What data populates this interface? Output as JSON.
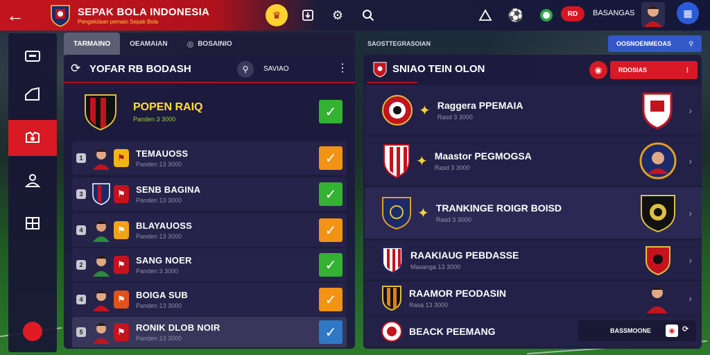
{
  "header": {
    "title": "SEPAK BOLA INDONESIA",
    "subtitle": "Pengelolaan pemain Sepak Bola",
    "user_name": "BASANGAS",
    "notif_label": "RD"
  },
  "tabs": [
    {
      "label": "TARMAINO"
    },
    {
      "label": "OEAMAIAN"
    },
    {
      "label": "BOSAINIO"
    }
  ],
  "tabs_right_label": "SAOSTTEGRASOIAN",
  "left_panel": {
    "title": "YOFAR RB BODASH",
    "right_label": "SAVIAO",
    "featured": {
      "name": "POPEN RAIQ",
      "sub": "Panden 3 3000"
    },
    "rows": [
      {
        "rank": "1",
        "name": "TEMAUOSS",
        "sub": "Panden 13 3000",
        "state": "orange"
      },
      {
        "rank": "3",
        "name": "SENB BAGINA",
        "sub": "Panden 13 3000",
        "state": "green"
      },
      {
        "rank": "4",
        "name": "BLAYAUOSS",
        "sub": "Panden 13 3000",
        "state": "orange"
      },
      {
        "rank": "2",
        "name": "SANG NOER",
        "sub": "Panden 3 3000",
        "state": "green"
      },
      {
        "rank": "4",
        "name": "BOIGA SUB",
        "sub": "Panden 13 3000",
        "state": "orange"
      },
      {
        "rank": "5",
        "name": "RONIK DLOB NOIR",
        "sub": "Panden 13 3000",
        "state": "blue"
      }
    ]
  },
  "right_panel": {
    "title": "SNIAO TEIN OLON",
    "button_label": "RDOSIAS",
    "search_label": "OOSNOENMEOAS",
    "bottom_label": "BASSMOONE",
    "rows": [
      {
        "name": "Raggera PPEMAIA",
        "sub": "Rasd 3 3000"
      },
      {
        "name": "Maastor PEGMOGSA",
        "sub": "Rasd 3 3000"
      },
      {
        "name": "TRANKINGE ROIGR BOISD",
        "sub": "Rasd 3 3000"
      },
      {
        "name": "RAAKIAUG PEBDASSE",
        "sub": "Masanga 13 3000"
      },
      {
        "name": "RAAMOR PEODASIN",
        "sub": "Rasa 13 3000"
      },
      {
        "name": "BEACK PEEMANG",
        "sub": ""
      }
    ]
  },
  "icons": {
    "back": "arrow-left-icon",
    "settings": "gear-icon",
    "search": "search-icon",
    "check": "check-icon",
    "chevron": "chevron-right-icon"
  },
  "colors": {
    "accent_red": "#d71a23",
    "check_green": "#34b232",
    "check_orange": "#f39313",
    "check_blue": "#2e78c6",
    "panel_bg": "#1c1a3e"
  }
}
